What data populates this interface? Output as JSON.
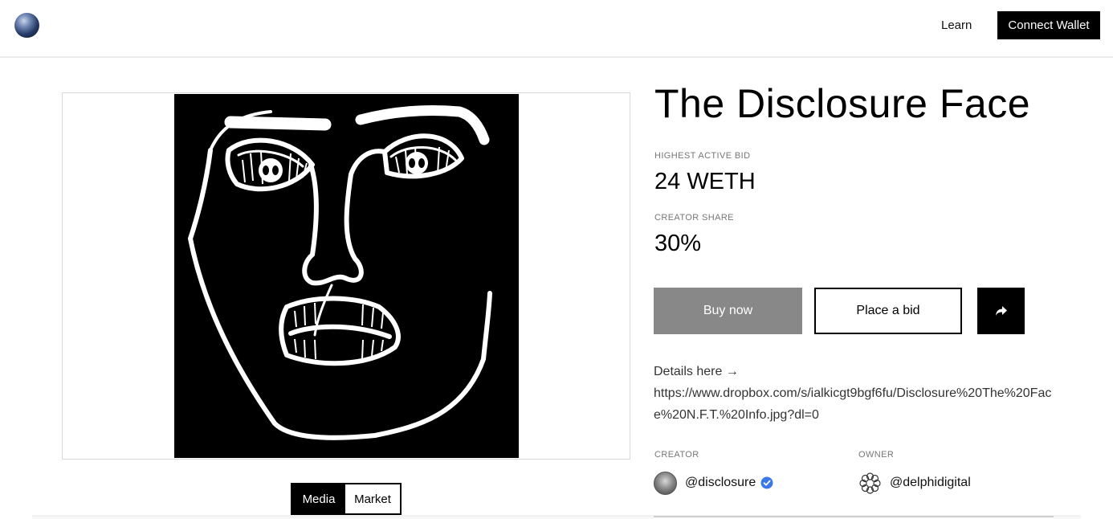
{
  "header": {
    "learn_label": "Learn",
    "connect_label": "Connect Wallet",
    "logo_icon": "globe-logo-icon"
  },
  "media_toggle": {
    "media_label": "Media",
    "market_label": "Market"
  },
  "nft": {
    "title": "The Disclosure Face",
    "highest_bid_label": "HIGHEST ACTIVE BID",
    "highest_bid_value": "24 WETH",
    "creator_share_label": "CREATOR SHARE",
    "creator_share_value": "30%",
    "buy_label": "Buy now",
    "bid_label": "Place a bid",
    "share_icon": "share-arrow-icon",
    "details_prefix": "Details here →",
    "details_url": "https://www.dropbox.com/s/ialkicgt9bgf6fu/Disclosure%20The%20Face%20N.F.T.%20Info.jpg?dl=0",
    "creator_label": "CREATOR",
    "creator_handle": "@disclosure",
    "owner_label": "OWNER",
    "owner_handle": "@delphidigital"
  },
  "colors": {
    "buy_bg": "#888888",
    "verified": "#3b78e7",
    "primary": "#000000"
  }
}
